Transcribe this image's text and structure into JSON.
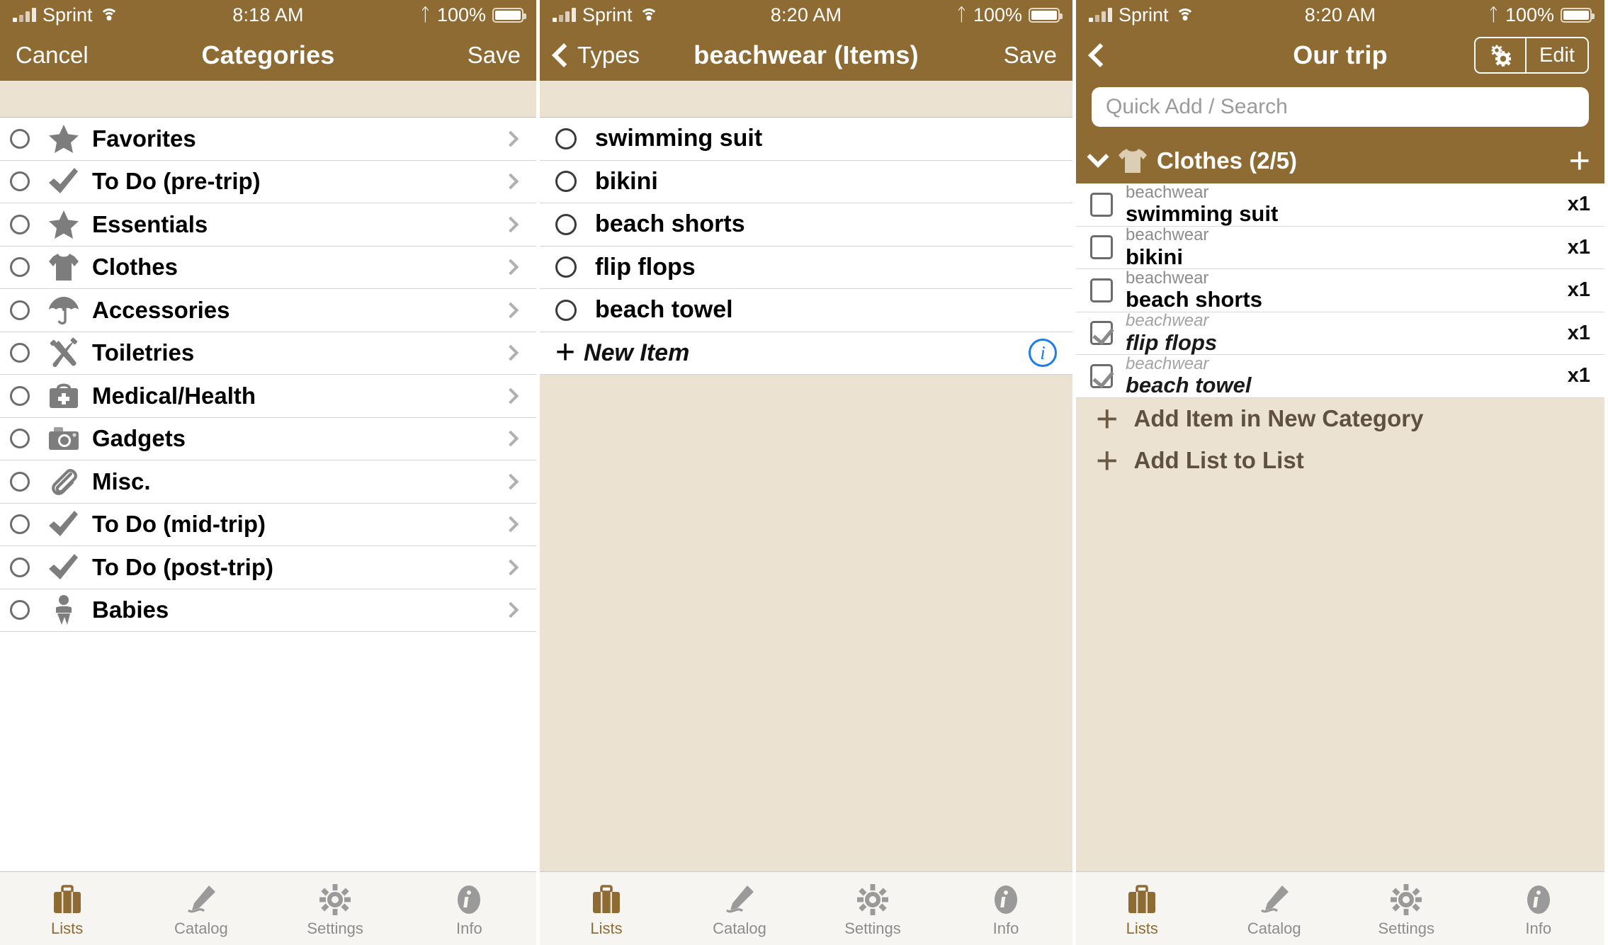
{
  "theme": {
    "brand": "#8f6b34",
    "beige": "#ece2d2",
    "icon_gray": "#7d7d7d",
    "info_blue": "#1b7ee8"
  },
  "panels": [
    {
      "status": {
        "carrier": "Sprint",
        "time": "8:18 AM",
        "battery_pct": "100%",
        "wifi_icon": "wifi-icon",
        "bluetooth_icon": "bluetooth-icon",
        "signal_icon": "signal-bars-icon",
        "battery_icon": "battery-icon"
      },
      "nav": {
        "left_label": "Cancel",
        "title": "Categories",
        "right_label": "Save"
      },
      "rows": [
        {
          "label": "Favorites",
          "icon": "star-icon"
        },
        {
          "label": "To Do (pre-trip)",
          "icon": "checkmark-icon"
        },
        {
          "label": "Essentials",
          "icon": "star-icon"
        },
        {
          "label": "Clothes",
          "icon": "tshirt-icon"
        },
        {
          "label": "Accessories",
          "icon": "umbrella-icon"
        },
        {
          "label": "Toiletries",
          "icon": "toiletries-icon"
        },
        {
          "label": "Medical/Health",
          "icon": "first-aid-kit-icon"
        },
        {
          "label": "Gadgets",
          "icon": "camera-icon"
        },
        {
          "label": "Misc.",
          "icon": "paperclip-icon"
        },
        {
          "label": "To Do (mid-trip)",
          "icon": "checkmark-icon"
        },
        {
          "label": "To Do (post-trip)",
          "icon": "checkmark-icon"
        },
        {
          "label": "Babies",
          "icon": "baby-icon"
        }
      ]
    },
    {
      "status": {
        "carrier": "Sprint",
        "time": "8:20 AM",
        "battery_pct": "100%",
        "wifi_icon": "wifi-icon",
        "bluetooth_icon": "bluetooth-icon",
        "signal_icon": "signal-bars-icon",
        "battery_icon": "battery-icon"
      },
      "nav": {
        "back_label": "Types",
        "title": "beachwear (Items)",
        "right_label": "Save"
      },
      "items": [
        {
          "label": "swimming suit"
        },
        {
          "label": "bikini"
        },
        {
          "label": "beach shorts"
        },
        {
          "label": "flip flops"
        },
        {
          "label": "beach towel"
        }
      ],
      "new_item": {
        "label": "New Item",
        "plus_icon": "plus-icon",
        "info_icon": "info-icon"
      }
    },
    {
      "status": {
        "carrier": "Sprint",
        "time": "8:20 AM",
        "battery_pct": "100%",
        "wifi_icon": "wifi-icon",
        "bluetooth_icon": "bluetooth-icon",
        "signal_icon": "signal-bars-icon",
        "battery_icon": "battery-icon"
      },
      "nav": {
        "back_icon": "chevron-left-icon",
        "title": "Our trip",
        "gear_icon": "gears-icon",
        "edit_label": "Edit"
      },
      "search": {
        "placeholder": "Quick Add / Search"
      },
      "category": {
        "title": "Clothes (2/5)",
        "icon": "tshirt-icon",
        "collapse_icon": "chevron-down-icon",
        "add_icon": "plus-icon"
      },
      "items": [
        {
          "sub": "beachwear",
          "name": "swimming suit",
          "qty": "x1",
          "checked": false
        },
        {
          "sub": "beachwear",
          "name": "bikini",
          "qty": "x1",
          "checked": false
        },
        {
          "sub": "beachwear",
          "name": "beach shorts",
          "qty": "x1",
          "checked": false
        },
        {
          "sub": "beachwear",
          "name": "flip flops",
          "qty": "x1",
          "checked": true
        },
        {
          "sub": "beachwear",
          "name": "beach towel",
          "qty": "x1",
          "checked": true
        }
      ],
      "actions": [
        {
          "label": "Add Item in New Category",
          "icon": "plus-icon"
        },
        {
          "label": "Add List to List",
          "icon": "plus-icon"
        }
      ]
    }
  ],
  "tabbar": {
    "tabs": [
      {
        "label": "Lists",
        "icon": "suitcase-icon",
        "active": true
      },
      {
        "label": "Catalog",
        "icon": "pencil-icon",
        "active": false
      },
      {
        "label": "Settings",
        "icon": "gear-icon",
        "active": false
      },
      {
        "label": "Info",
        "icon": "info-icon",
        "active": false
      }
    ]
  }
}
